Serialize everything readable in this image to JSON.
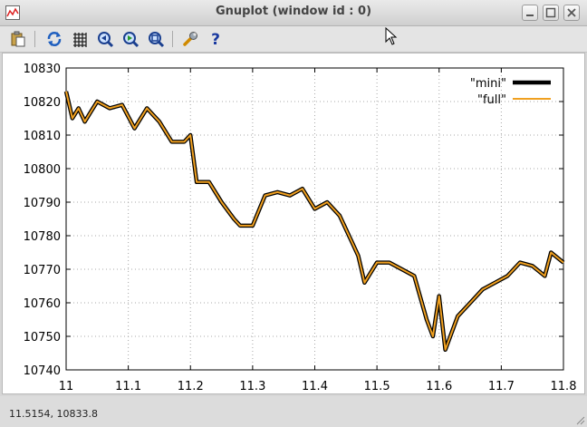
{
  "window": {
    "title": "Gnuplot (window id : 0)"
  },
  "toolbar": {
    "buttons": [
      {
        "name": "copy-clipboard-icon"
      },
      {
        "name": "replot-icon"
      },
      {
        "name": "grid-icon"
      },
      {
        "name": "zoom-previous-icon"
      },
      {
        "name": "zoom-next-icon"
      },
      {
        "name": "unzoom-icon"
      },
      {
        "name": "settings-icon"
      },
      {
        "name": "help-icon"
      }
    ]
  },
  "status": {
    "coords": "11.5154,  10833.8"
  },
  "chart_data": {
    "type": "line",
    "title": "",
    "xlabel": "",
    "ylabel": "",
    "xlim": [
      11,
      11.8
    ],
    "ylim": [
      10740,
      10830
    ],
    "x_ticks": [
      "11",
      "11.1",
      "11.2",
      "11.3",
      "11.4",
      "11.5",
      "11.6",
      "11.7",
      "11.8"
    ],
    "y_ticks": [
      "10740",
      "10750",
      "10760",
      "10770",
      "10780",
      "10790",
      "10800",
      "10810",
      "10820",
      "10830"
    ],
    "grid": true,
    "legend_position": "top-right",
    "series": [
      {
        "name": "\"mini\"",
        "color": "#000000",
        "x": [
          11.0,
          11.01,
          11.02,
          11.03,
          11.04,
          11.05,
          11.07,
          11.09,
          11.11,
          11.13,
          11.15,
          11.17,
          11.19,
          11.2,
          11.21,
          11.23,
          11.25,
          11.27,
          11.28,
          11.3,
          11.32,
          11.34,
          11.36,
          11.38,
          11.4,
          11.42,
          11.44,
          11.46,
          11.47,
          11.48,
          11.5,
          11.52,
          11.54,
          11.56,
          11.58,
          11.59,
          11.6,
          11.61,
          11.63,
          11.65,
          11.67,
          11.69,
          11.71,
          11.73,
          11.75,
          11.77,
          11.78,
          11.8
        ],
        "y": [
          10823,
          10815,
          10818,
          10814,
          10817,
          10820,
          10818,
          10819,
          10812,
          10818,
          10814,
          10808,
          10808,
          10810,
          10796,
          10796,
          10790,
          10785,
          10783,
          10783,
          10792,
          10793,
          10792,
          10794,
          10788,
          10790,
          10786,
          10778,
          10774,
          10766,
          10772,
          10772,
          10770,
          10768,
          10755,
          10750,
          10762,
          10746,
          10756,
          10760,
          10764,
          10766,
          10768,
          10772,
          10771,
          10768,
          10775,
          10772
        ]
      },
      {
        "name": "\"full\"",
        "color": "#f0a020",
        "x": [
          11.0,
          11.01,
          11.02,
          11.03,
          11.04,
          11.05,
          11.07,
          11.09,
          11.11,
          11.13,
          11.15,
          11.17,
          11.19,
          11.2,
          11.21,
          11.23,
          11.25,
          11.27,
          11.28,
          11.3,
          11.32,
          11.34,
          11.36,
          11.38,
          11.4,
          11.42,
          11.44,
          11.46,
          11.47,
          11.48,
          11.5,
          11.52,
          11.54,
          11.56,
          11.58,
          11.59,
          11.6,
          11.61,
          11.63,
          11.65,
          11.67,
          11.69,
          11.71,
          11.73,
          11.75,
          11.77,
          11.78,
          11.8
        ],
        "y": [
          10823,
          10815,
          10818,
          10814,
          10817,
          10820,
          10818,
          10819,
          10812,
          10818,
          10814,
          10808,
          10808,
          10810,
          10796,
          10796,
          10790,
          10785,
          10783,
          10783,
          10792,
          10793,
          10792,
          10794,
          10788,
          10790,
          10786,
          10778,
          10774,
          10766,
          10772,
          10772,
          10770,
          10768,
          10755,
          10750,
          10762,
          10746,
          10756,
          10760,
          10764,
          10766,
          10768,
          10772,
          10771,
          10768,
          10775,
          10772
        ]
      }
    ]
  }
}
